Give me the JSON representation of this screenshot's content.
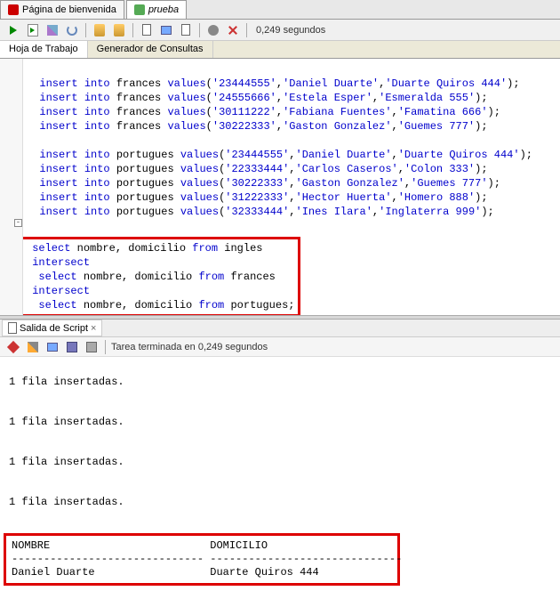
{
  "tabs": {
    "welcome": "Página de bienvenida",
    "file": "prueba"
  },
  "toolbar": {
    "elapsed": "0,249 segundos"
  },
  "subtabs": {
    "worksheet": "Hoja de Trabajo",
    "querybuilder": "Generador de Consultas"
  },
  "code": {
    "lines_frances": [
      "insert into frances values('23444555','Daniel Duarte','Duarte Quiros 444');",
      "insert into frances values('24555666','Estela Esper','Esmeralda 555');",
      "insert into frances values('30111222','Fabiana Fuentes','Famatina 666');",
      "insert into frances values('30222333','Gaston Gonzalez','Guemes 777');"
    ],
    "lines_portugues": [
      "insert into portugues values('23444555','Daniel Duarte','Duarte Quiros 444');",
      "insert into portugues values('22333444','Carlos Caseros','Colon 333');",
      "insert into portugues values('30222333','Gaston Gonzalez','Guemes 777');",
      "insert into portugues values('31222333','Hector Huerta','Homero 888');",
      "insert into portugues values('32333444','Ines Ilara','Inglaterra 999');"
    ],
    "query": [
      "select nombre, domicilio from ingles",
      "intersect",
      " select nombre, domicilio from frances",
      "intersect",
      " select nombre, domicilio from portugues;"
    ]
  },
  "output": {
    "tab_label": "Salida de Script",
    "status": "Tarea terminada en 0,249 segundos",
    "rows_msg": "1 fila insertadas.",
    "result_header_nombre": "NOMBRE",
    "result_header_domicilio": "DOMICILIO",
    "sep_nombre": "------------------------------",
    "sep_domicilio": "------------------------------",
    "result_nombre": "Daniel Duarte",
    "result_domicilio": "Duarte Quiros 444"
  }
}
